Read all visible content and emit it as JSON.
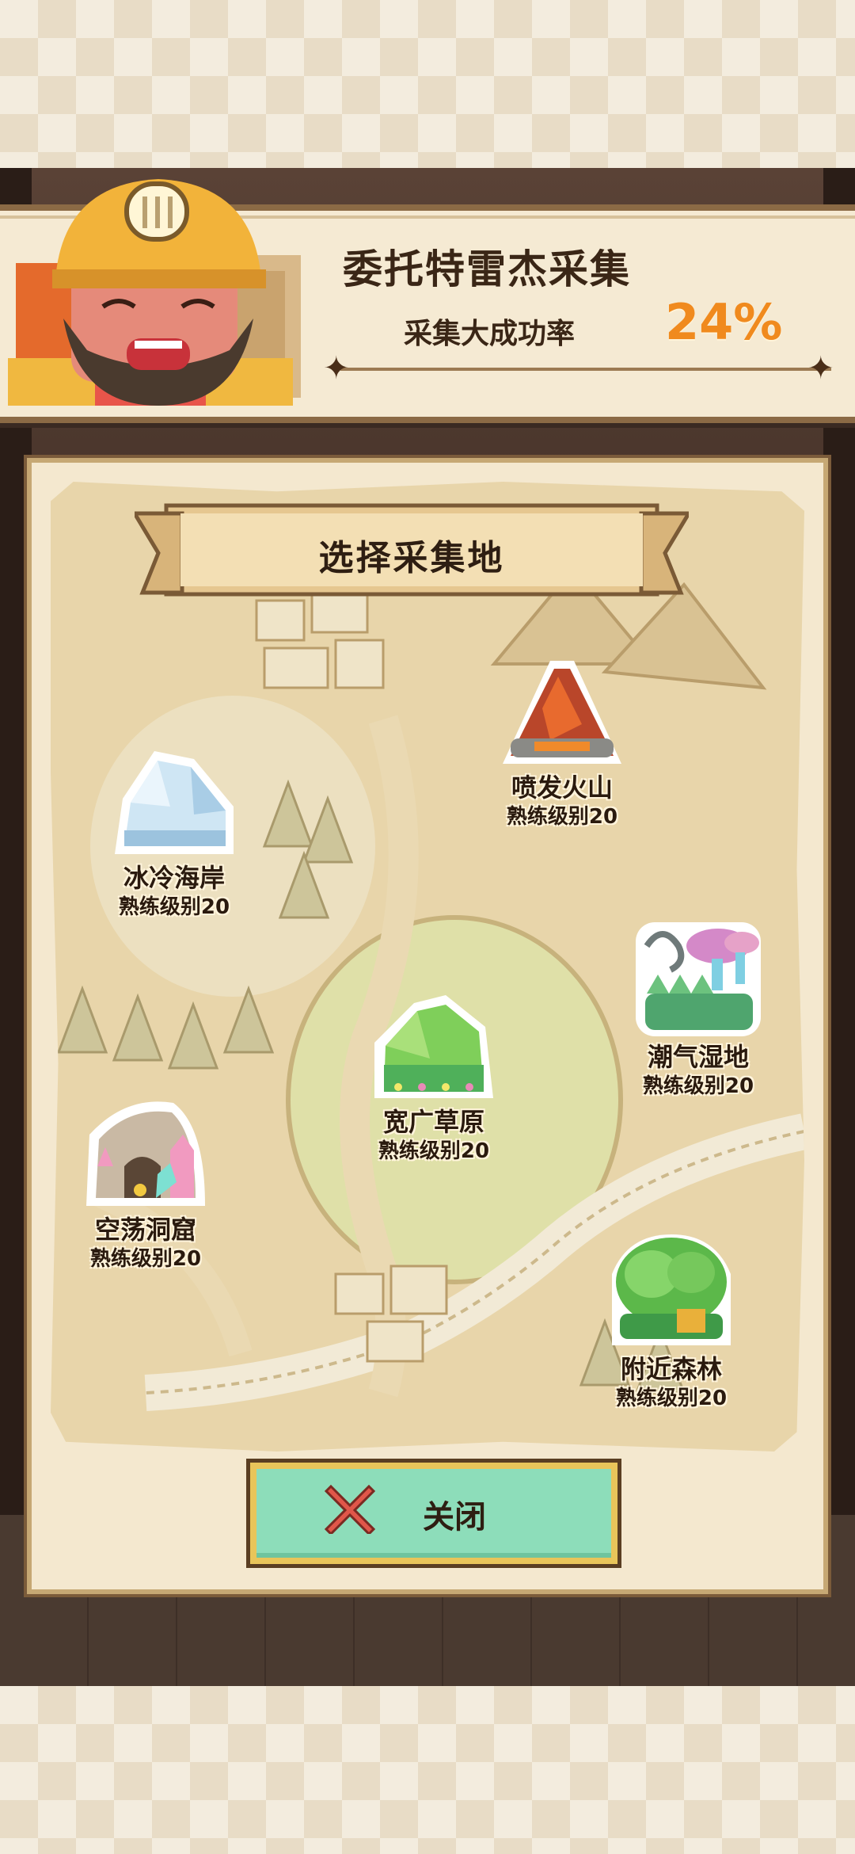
{
  "header": {
    "title": "委托特雷杰采集",
    "rate_label": "采集大成功率",
    "rate_value": "24%"
  },
  "map": {
    "title": "选择采集地",
    "locations": [
      {
        "name": "喷发火山",
        "level": "熟练级别20",
        "icon": "volcano-icon"
      },
      {
        "name": "冰冷海岸",
        "level": "熟练级别20",
        "icon": "iceberg-icon"
      },
      {
        "name": "潮气湿地",
        "level": "熟练级别20",
        "icon": "mushroom-swamp-icon"
      },
      {
        "name": "宽广草原",
        "level": "熟练级别20",
        "icon": "grassland-hill-icon"
      },
      {
        "name": "空荡洞窟",
        "level": "熟练级别20",
        "icon": "crystal-cave-icon"
      },
      {
        "name": "附近森林",
        "level": "熟练级别20",
        "icon": "forest-bush-icon"
      }
    ]
  },
  "close_button": {
    "label": "关闭",
    "icon": "close-x-icon"
  },
  "colors": {
    "accent_orange": "#f08a1e",
    "button_green": "#8dddba",
    "close_x_red": "#e0574a",
    "parchment": "#e8d5aa"
  }
}
